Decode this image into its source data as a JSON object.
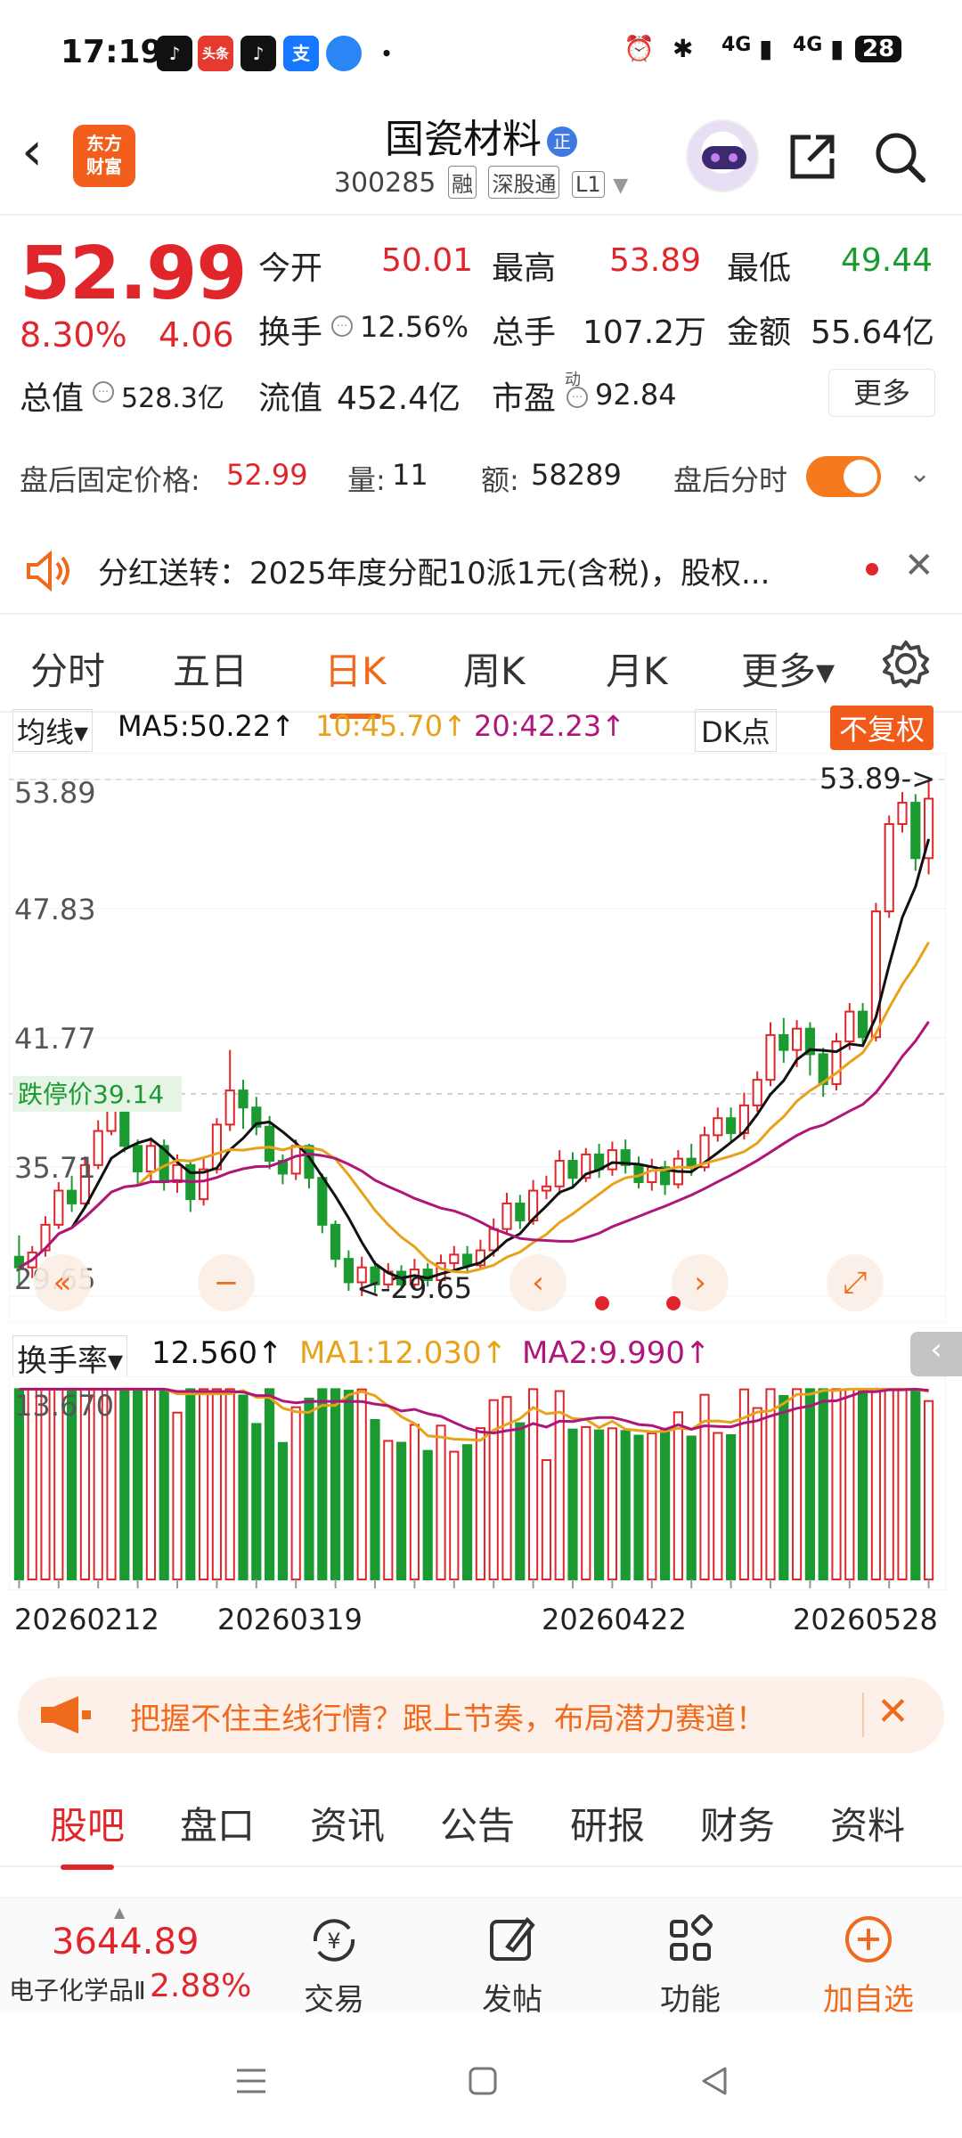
{
  "status_bar": {
    "time": "17:19",
    "apps": [
      "douyin",
      "toutiao",
      "douyin",
      "alipay",
      "bilibili-blue",
      "dot"
    ],
    "toutiao_label": "头条",
    "alipay_label": "支",
    "network1": "4G",
    "network2": "4G",
    "battery": "28"
  },
  "header": {
    "logo_line1": "东方",
    "logo_line2": "财富",
    "stock_name": "国瓷材料",
    "name_badge": "正",
    "stock_code": "300285",
    "tags": [
      "融",
      "深股通",
      "L1"
    ]
  },
  "quote": {
    "price": "52.99",
    "change_pct": "8.30%",
    "change_abs": "4.06",
    "open_label": "今开",
    "open": "50.01",
    "high_label": "最高",
    "high": "53.89",
    "low_label": "最低",
    "low": "49.44",
    "turnover_label": "换手",
    "turnover": "12.56%",
    "volume_label": "总手",
    "volume": "107.2万",
    "amount_label": "金额",
    "amount": "55.64亿",
    "mktcap_label": "总值",
    "mktcap": "528.3亿",
    "float_label": "流值",
    "float_cap": "452.4亿",
    "pe_label": "市盈",
    "pe_sup": "动",
    "pe": "92.84",
    "more": "更多"
  },
  "after_hours": {
    "price_label": "盘后固定价格:",
    "price": "52.99",
    "qty_label": "量:",
    "qty": "11",
    "amt_label": "额:",
    "amt": "58289",
    "timeshare_label": "盘后分时"
  },
  "dividend": {
    "text": "分红送转：2025年度分配10派1元(含税)，股权..."
  },
  "period_tabs": [
    "分时",
    "五日",
    "日K",
    "周K",
    "月K",
    "更多▾"
  ],
  "active_period": "日K",
  "chart_legend": {
    "ma_select": "均线▾",
    "ma5": "MA5:50.22↑",
    "ma10": "10:45.70↑",
    "ma20": "20:42.23↑",
    "dk": "DK点",
    "fq": "不复权"
  },
  "vol_legend": {
    "select": "换手率▾",
    "value": "12.560↑",
    "ma1": "MA1:12.030↑",
    "ma2": "MA2:9.990↑"
  },
  "banner": {
    "text": "把握不住主线行情？跟上节奏，布局潜力赛道！"
  },
  "content_tabs": [
    "股吧",
    "盘口",
    "资讯",
    "公告",
    "研报",
    "财务",
    "资料"
  ],
  "active_content_tab": "股吧",
  "toolbar": {
    "index_value": "3644.89",
    "index_name": "电子化学品Ⅱ",
    "index_pct": "2.88%",
    "trade": "交易",
    "post": "发帖",
    "func": "功能",
    "add": "加自选"
  },
  "colors": {
    "up": "#e0262b",
    "down": "#1a9a30",
    "accent": "#f06a1e",
    "ma5": "#111111",
    "ma10": "#e8a21a",
    "ma20": "#b0157a"
  },
  "chart_data": {
    "type": "candlestick",
    "title": "",
    "y_ticks": [
      "53.89",
      "47.83",
      "41.77",
      "35.71",
      "29.65"
    ],
    "ylim": [
      29.65,
      53.89
    ],
    "limit_down_label": "跌停价",
    "limit_down_price": "39.14",
    "limit_down_value": 39.14,
    "max_label": "53.89->",
    "min_label": "<-29.65",
    "x_ticks": [
      "20260212",
      "20260319",
      "20260422",
      "20260528"
    ],
    "candles": [
      [
        31.5,
        31.0,
        32.5,
        30.2
      ],
      [
        31.0,
        31.7,
        32.0,
        30.5
      ],
      [
        31.8,
        33.0,
        33.4,
        31.5
      ],
      [
        33.0,
        34.6,
        35.0,
        32.8
      ],
      [
        34.6,
        34.0,
        35.3,
        33.6
      ],
      [
        34.0,
        35.8,
        36.2,
        33.8
      ],
      [
        35.8,
        37.4,
        37.9,
        35.6
      ],
      [
        37.4,
        38.8,
        39.0,
        37.2
      ],
      [
        38.8,
        36.7,
        39.2,
        36.4
      ],
      [
        36.7,
        35.5,
        37.0,
        34.8
      ],
      [
        35.5,
        36.7,
        37.1,
        35.0
      ],
      [
        36.7,
        35.0,
        37.0,
        34.6
      ],
      [
        35.0,
        35.8,
        36.3,
        34.5
      ],
      [
        35.8,
        34.2,
        36.0,
        33.6
      ],
      [
        34.2,
        35.6,
        36.1,
        33.9
      ],
      [
        35.6,
        37.7,
        38.0,
        35.4
      ],
      [
        37.7,
        39.3,
        41.2,
        37.4
      ],
      [
        39.3,
        38.5,
        39.8,
        37.5
      ],
      [
        38.5,
        37.6,
        39.0,
        37.2
      ],
      [
        37.6,
        36.0,
        38.1,
        35.6
      ],
      [
        36.0,
        35.4,
        36.3,
        34.9
      ],
      [
        35.4,
        36.7,
        37.0,
        35.1
      ],
      [
        36.7,
        35.2,
        36.8,
        34.7
      ],
      [
        35.2,
        33.0,
        35.4,
        32.6
      ],
      [
        33.0,
        31.4,
        33.2,
        31.0
      ],
      [
        31.4,
        30.3,
        31.8,
        29.9
      ],
      [
        30.3,
        31.0,
        31.5,
        29.65
      ],
      [
        31.0,
        30.2,
        31.3,
        29.8
      ],
      [
        30.2,
        30.8,
        31.2,
        30.0
      ],
      [
        30.8,
        30.2,
        31.1,
        29.9
      ],
      [
        30.2,
        30.9,
        31.4,
        30.0
      ],
      [
        30.9,
        30.4,
        31.2,
        30.1
      ],
      [
        30.4,
        31.2,
        31.6,
        30.2
      ],
      [
        31.2,
        31.6,
        32.0,
        30.9
      ],
      [
        31.6,
        31.1,
        32.0,
        30.8
      ],
      [
        31.1,
        31.8,
        32.3,
        30.9
      ],
      [
        31.8,
        32.8,
        33.3,
        31.5
      ],
      [
        32.8,
        34.0,
        34.5,
        32.6
      ],
      [
        34.0,
        33.2,
        34.4,
        32.8
      ],
      [
        33.2,
        34.6,
        35.1,
        33.0
      ],
      [
        34.6,
        34.8,
        35.3,
        34.2
      ],
      [
        34.8,
        36.0,
        36.5,
        34.4
      ],
      [
        36.0,
        35.2,
        36.4,
        34.8
      ],
      [
        35.2,
        36.3,
        36.6,
        35.0
      ],
      [
        36.3,
        35.6,
        36.8,
        35.2
      ],
      [
        35.6,
        36.5,
        36.9,
        35.3
      ],
      [
        36.5,
        35.8,
        37.0,
        35.4
      ],
      [
        35.8,
        35.0,
        36.2,
        34.7
      ],
      [
        35.0,
        35.7,
        36.1,
        34.6
      ],
      [
        35.7,
        34.9,
        36.0,
        34.4
      ],
      [
        34.9,
        36.1,
        36.5,
        34.7
      ],
      [
        36.1,
        35.7,
        36.8,
        35.3
      ],
      [
        35.7,
        37.2,
        37.6,
        35.5
      ],
      [
        37.2,
        38.0,
        38.5,
        36.9
      ],
      [
        38.0,
        37.3,
        38.5,
        36.9
      ],
      [
        37.3,
        38.6,
        39.2,
        37.0
      ],
      [
        38.6,
        39.8,
        40.2,
        38.3
      ],
      [
        39.8,
        41.9,
        42.5,
        39.5
      ],
      [
        41.9,
        41.2,
        42.7,
        40.6
      ],
      [
        41.2,
        42.2,
        42.6,
        40.4
      ],
      [
        42.2,
        41.0,
        42.5,
        40.0
      ],
      [
        41.0,
        39.6,
        41.3,
        39.0
      ],
      [
        39.6,
        41.6,
        42.0,
        39.3
      ],
      [
        41.6,
        43.0,
        43.4,
        41.2
      ],
      [
        43.0,
        41.8,
        43.4,
        41.4
      ],
      [
        41.8,
        47.7,
        48.1,
        41.6
      ],
      [
        47.7,
        51.8,
        52.2,
        47.4
      ],
      [
        51.8,
        52.8,
        53.3,
        51.4
      ],
      [
        52.8,
        50.2,
        53.2,
        49.6
      ],
      [
        50.2,
        52.99,
        53.89,
        49.44
      ]
    ],
    "volume_ylim": [
      0,
      13.67
    ],
    "volume_tick": "13.670"
  }
}
